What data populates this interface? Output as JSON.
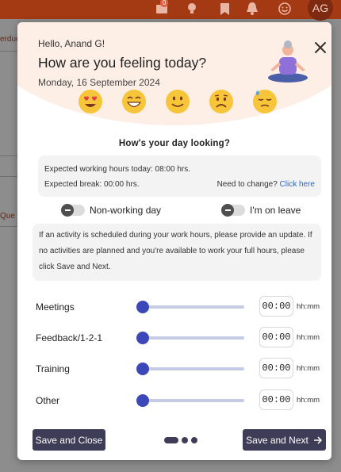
{
  "topbar": {
    "badge": "0",
    "user_initials": "AG"
  },
  "background": {
    "fragment_top": "erdue",
    "fragment_mid": "Que"
  },
  "modal": {
    "greeting": "Hello, Anand G!",
    "title": "How are you feeling today?",
    "date": "Monday, 16 September 2024",
    "moods": [
      "heart-eyes-emoji",
      "grinning-emoji",
      "smiling-emoji",
      "sad-emoji",
      "downcast-sweat-emoji"
    ],
    "day_heading": "How's your day looking?",
    "expected_hours": "Expected working hours today: 08:00 hrs.",
    "expected_break": "Expected break: 00:00 hrs.",
    "need_change": "Need to change?",
    "click_here": "Click here",
    "non_working_day": "Non-working day",
    "on_leave": "I'm on leave",
    "notice": "If an activity is scheduled during your work hours, please provide an update. If no activities are planned and you're available to work your full hours, please click Save and Next.",
    "activities": [
      {
        "label": "Meetings",
        "hh": "00",
        "mm": "00",
        "unit": "hh:mm",
        "level": 0
      },
      {
        "label": "Feedback/1-2-1",
        "hh": "00",
        "mm": "00",
        "unit": "hh:mm",
        "level": 0
      },
      {
        "label": "Training",
        "hh": "00",
        "mm": "00",
        "unit": "hh:mm",
        "level": 0
      },
      {
        "label": "Other",
        "hh": "00",
        "mm": "00",
        "unit": "hh:mm",
        "level": 0
      }
    ],
    "save_close": "Save and Close",
    "save_next": "Save and Next",
    "step_current": 1,
    "step_total": 3
  },
  "colors": {
    "topbar": "#a33a14",
    "header_tint": "#fdeee6",
    "button": "#3d3d57",
    "slider_thumb": "#3d48b8",
    "link": "#2f66c7"
  }
}
